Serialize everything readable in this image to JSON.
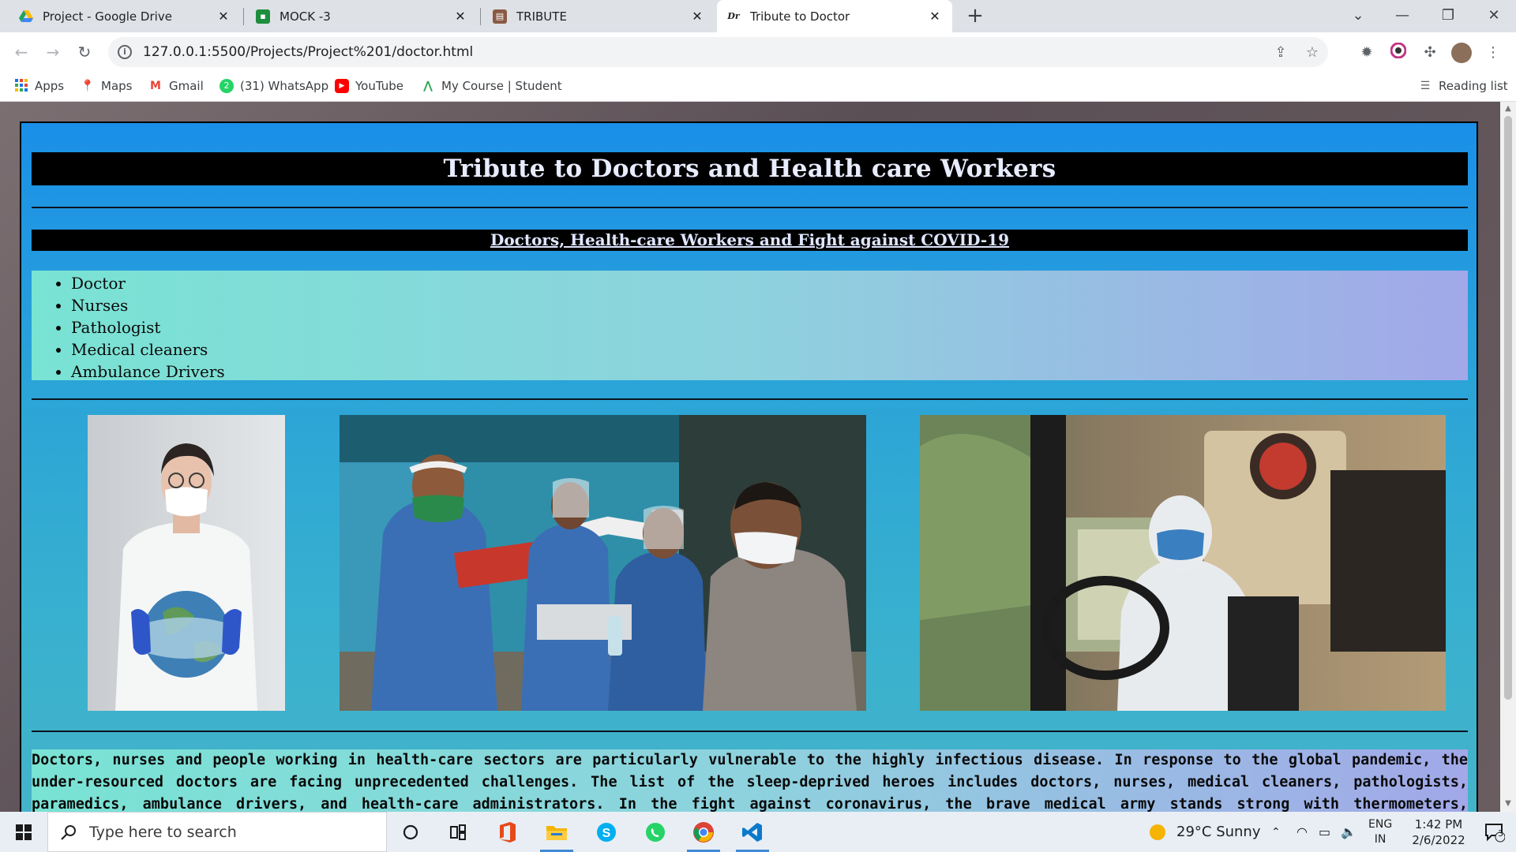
{
  "browser": {
    "tabs": [
      {
        "title": "Project - Google Drive",
        "icon": "google-drive-icon",
        "color": "#1fa463"
      },
      {
        "title": "MOCK -3",
        "icon": "google-classroom-icon",
        "color": "#1e8e3e"
      },
      {
        "title": "TRIBUTE",
        "icon": "document-icon",
        "color": "#8a5a44"
      },
      {
        "title": "Tribute to Doctor",
        "icon": "doctor-tab-icon",
        "color": "#202124"
      }
    ],
    "address": "127.0.0.1:5500/Projects/Project%201/doctor.html",
    "bookmarks": [
      {
        "label": "Apps",
        "icon": "apps-grid-icon"
      },
      {
        "label": "Maps",
        "icon": "maps-pin-icon"
      },
      {
        "label": "Gmail",
        "icon": "gmail-icon"
      },
      {
        "label": "(31) WhatsApp",
        "icon": "whatsapp-icon"
      },
      {
        "label": "YouTube",
        "icon": "youtube-icon"
      },
      {
        "label": "My Course | Student",
        "icon": "course-icon"
      }
    ],
    "reading_list": "Reading list"
  },
  "page": {
    "title": "Tribute to Doctors and Health care Workers",
    "subtitle": "Doctors, Health-care Workers and Fight against COVID-19",
    "list": [
      "Doctor",
      "Nurses",
      "Pathologist",
      "Medical cleaners",
      "Ambulance Drivers"
    ],
    "paragraph": "Doctors, nurses and people working in health-care sectors are particularly vulnerable to the highly infectious disease. In response to the global pandemic, the under-resourced doctors are facing unprecedented challenges. The list of the sleep-deprived heroes includes doctors, nurses, medical cleaners, pathologists, paramedics, ambulance drivers, and health-care administrators. In the fight against coronavirus, the brave medical army stands strong with thermometers, stethoscopes, and ventilators as their weapons. Not to forget, medical"
  },
  "taskbar": {
    "search_placeholder": "Type here to search",
    "weather": "29°C  Sunny",
    "lang_line1": "ENG",
    "lang_line2": "IN",
    "time": "1:42 PM",
    "date": "2/6/2022",
    "notifications": "3"
  }
}
